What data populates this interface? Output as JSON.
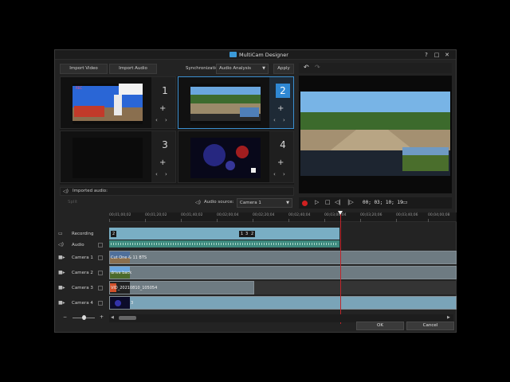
{
  "window": {
    "title": "MultiCam Designer",
    "help": "?",
    "maximize": "□",
    "close": "✕"
  },
  "toolbar": {
    "import_video": "Import Video",
    "import_audio": "Import Audio",
    "sync_label": "Synchronization:",
    "sync_value": "Audio Analysis",
    "apply": "Apply"
  },
  "cameras_grid": [
    {
      "number": "1",
      "selected": false
    },
    {
      "number": "2",
      "selected": true
    },
    {
      "number": "3",
      "selected": false
    },
    {
      "number": "4",
      "selected": false
    }
  ],
  "cell_controls": {
    "plus": "+",
    "prev": "‹",
    "next": "›"
  },
  "imported_audio": {
    "label": "Imported audio:"
  },
  "audio_source": {
    "label": "Audio source:",
    "value": "Camera 1",
    "dim_label": "Split"
  },
  "preview": {
    "undo": "↶",
    "redo": "↷",
    "timecode": "00; 03; 10; 19"
  },
  "transport": {
    "play": "▷",
    "stop": "□",
    "prev_frame": "◁|",
    "next_frame": "|▷",
    "export": "▭"
  },
  "ruler": {
    "ticks": [
      "00;01;00;02",
      "00;01;20;02",
      "00;01;40;02",
      "00;02;00;04",
      "00;02;20;04",
      "00;02;40;04",
      "00;03;00;04",
      "00;03;20;06",
      "00;03;40;06",
      "00;04;00;08"
    ]
  },
  "tracks": [
    {
      "label": "Recording",
      "icon": "monitor-icon"
    },
    {
      "label": "Audio",
      "icon": "speaker-icon"
    },
    {
      "label": "Camera 1",
      "icon": "camera-icon"
    },
    {
      "label": "Camera 2",
      "icon": "camera-icon"
    },
    {
      "label": "Camera 3",
      "icon": "camera-icon"
    },
    {
      "label": "Camera 4",
      "icon": "camera-icon"
    }
  ],
  "recording_badges": [
    "2",
    "1",
    "3",
    "2"
  ],
  "clips": {
    "camera1": "Cut One & 11 BTS",
    "camera2": "drive back",
    "camera3": "VID_20210810_105054",
    "camera4": "3"
  },
  "zoom": {
    "minus": "−",
    "plus": "+"
  },
  "scroll": {
    "left": "◀",
    "right": "▶"
  },
  "footer": {
    "ok": "OK",
    "cancel": "Cancel"
  },
  "colors": {
    "accent": "#2f88d4",
    "playhead": "#c0242a",
    "recording_track": "#79aec4",
    "audio_track": "#3e8a7f"
  }
}
